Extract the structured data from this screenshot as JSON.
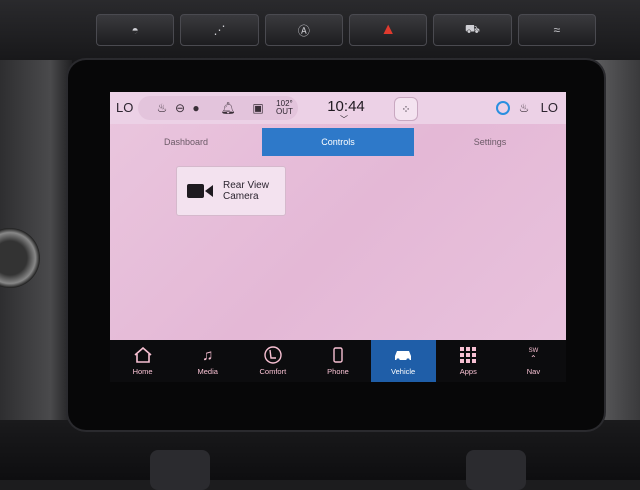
{
  "status_bar": {
    "temp_left": "LO",
    "temp_right": "LO",
    "outside_temp": "102°",
    "outside_label": "OUT",
    "clock": "10:44"
  },
  "tabs": [
    {
      "label": "Dashboard",
      "active": false
    },
    {
      "label": "Controls",
      "active": true
    },
    {
      "label": "Settings",
      "active": false
    }
  ],
  "card": {
    "label_line1": "Rear View",
    "label_line2": "Camera"
  },
  "nav": [
    {
      "label": "Home",
      "icon": "home-icon"
    },
    {
      "label": "Media",
      "icon": "music-note-icon"
    },
    {
      "label": "Comfort",
      "icon": "seat-icon"
    },
    {
      "label": "Phone",
      "icon": "phone-icon"
    },
    {
      "label": "Vehicle",
      "icon": "car-icon",
      "active": true
    },
    {
      "label": "Apps",
      "icon": "apps-grid-icon"
    },
    {
      "label": "Nav",
      "icon": "compass-icon",
      "compass": "SW"
    }
  ],
  "colors": {
    "screen_bg": "#e6bcd8",
    "active_tab": "#2e79c9",
    "nav_active": "#1f5ea8",
    "hazard": "#e03a2e"
  }
}
